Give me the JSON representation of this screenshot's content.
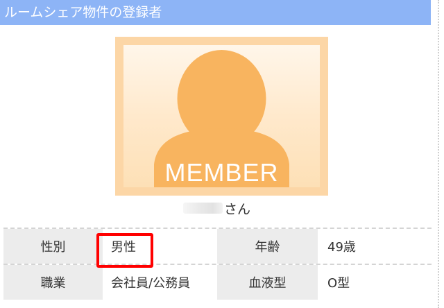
{
  "header": {
    "title": "ルームシェア物件の登録者"
  },
  "avatar": {
    "label": "MEMBER",
    "icon": "member-silhouette-icon",
    "colors": {
      "frame": "#fcd6a6",
      "inner": "#fff1dd",
      "silhouette": "#f8b45f"
    }
  },
  "profile": {
    "name_suffix": "さん"
  },
  "details": {
    "rows": [
      {
        "label1": "性別",
        "value1": "男性",
        "label2": "年齢",
        "value2": "49歳"
      },
      {
        "label1": "職業",
        "value1": "会社員/公務員",
        "label2": "血液型",
        "value2": "O型"
      }
    ]
  },
  "colors": {
    "header_bg": "#8db4f6",
    "label_bg": "#ececec",
    "highlight": "#ff0000"
  }
}
